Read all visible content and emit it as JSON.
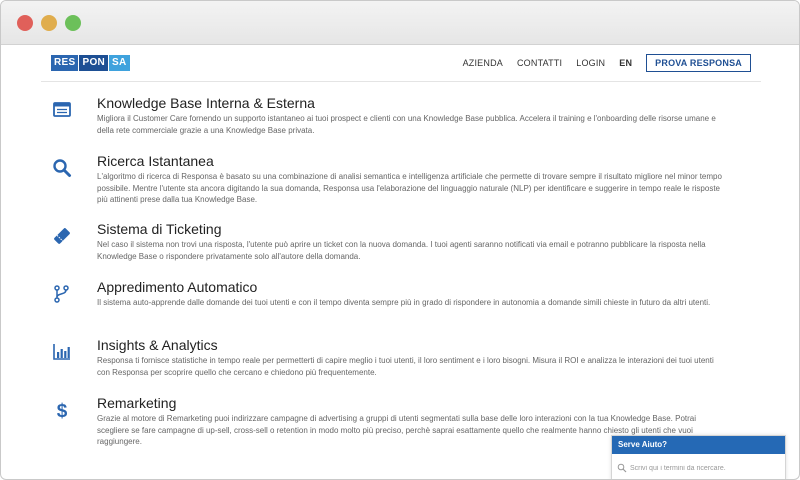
{
  "nav": {
    "logo_parts": [
      "RES",
      "PON",
      "SA"
    ],
    "links": [
      "AZIENDA",
      "CONTATTI",
      "LOGIN",
      "EN"
    ],
    "cta_label": "PROVA RESPONSA"
  },
  "features": [
    {
      "icon": "browser-window-icon",
      "title": "Knowledge Base Interna & Esterna",
      "description": "Migliora il Customer Care fornendo un supporto istantaneo ai tuoi prospect e clienti con una Knowledge Base pubblica. Accelera il training e l'onboarding delle risorse umane e della rete commerciale grazie a una Knowledge Base privata."
    },
    {
      "icon": "search-icon",
      "title": "Ricerca Istantanea",
      "description": "L'algoritmo di ricerca di Responsa è basato su una combinazione di analisi semantica e intelligenza artificiale che permette di trovare sempre il risultato migliore nel minor tempo possibile. Mentre l'utente sta ancora digitando la sua domanda, Responsa usa l'elaborazione del linguaggio naturale (NLP) per identificare e suggerire in tempo reale le risposte più attinenti prese dalla tua Knowledge Base."
    },
    {
      "icon": "ticket-icon",
      "title": "Sistema di Ticketing",
      "description": "Nel caso il sistema non trovi una risposta, l'utente può aprire un ticket con la nuova domanda. I tuoi agenti saranno notificati via email e potranno pubblicare la risposta nella Knowledge Base o rispondere privatamente solo all'autore della domanda."
    },
    {
      "icon": "branch-icon",
      "title": "Appredimento Automatico",
      "description": "Il sistema auto-apprende dalle domande dei tuoi utenti e con il tempo diventa sempre più in grado di rispondere in autonomia a domande simili chieste in futuro da altri utenti."
    },
    {
      "icon": "bar-chart-icon",
      "title": "Insights & Analytics",
      "description": "Responsa ti fornisce statistiche in tempo reale per permetterti di capire meglio i tuoi utenti, il loro sentiment e i loro bisogni. Misura il ROI e analizza le interazioni dei tuoi utenti con Responsa per scoprire quello che cercano e chiedono più frequentemente."
    },
    {
      "icon": "dollar-icon",
      "title": "Remarketing",
      "description": "Grazie al motore di Remarketing puoi indirizzare campagne di advertising a gruppi di utenti segmentati sulla base delle loro interazioni con la tua Knowledge Base. Potrai scegliere se fare campagne di up-sell, cross-sell o retention in modo molto più preciso, perchè saprai esattamente quello che realmente hanno chiesto gli utenti che vuoi raggiungere."
    }
  ],
  "help_widget": {
    "title": "Serve Aiuto?",
    "placeholder": "Scrivi qui i termini da ricercare."
  },
  "colors": {
    "accent": "#1f4f93",
    "icon": "#2b66b0",
    "widget_header": "#2569b5"
  }
}
